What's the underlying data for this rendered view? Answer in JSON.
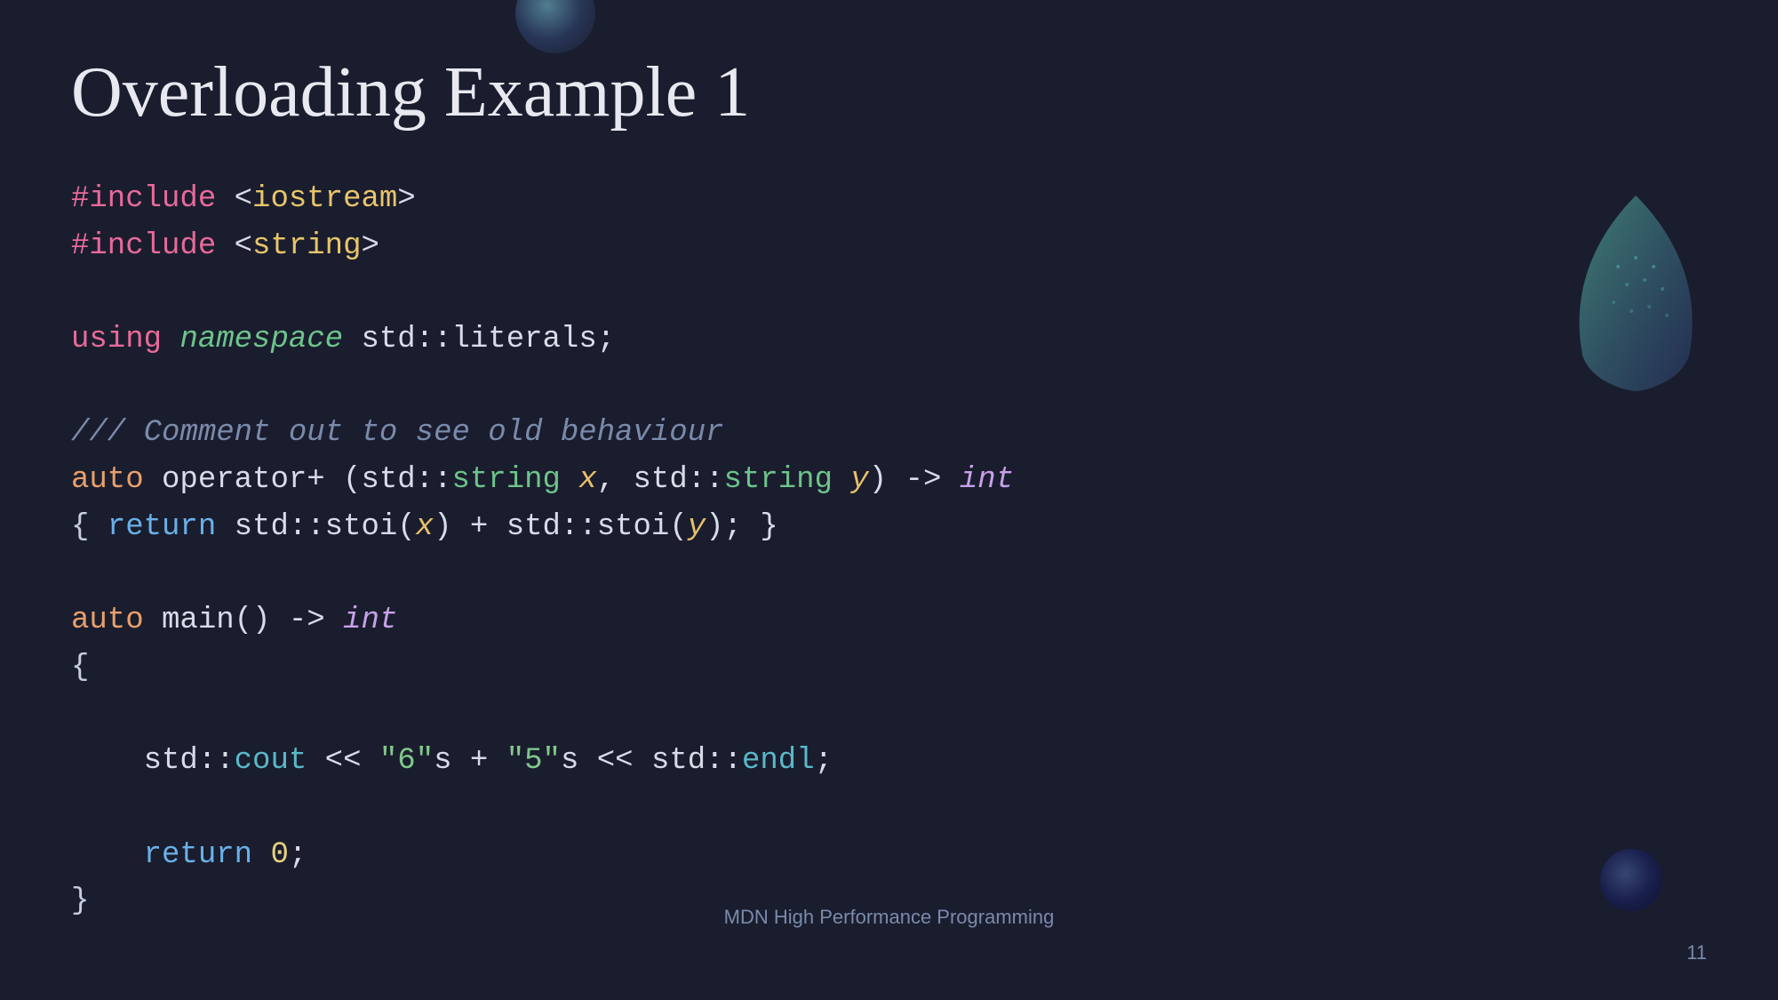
{
  "title": "Overloading Example 1",
  "footer": {
    "center": "MDN High Performance Programming",
    "page_number": "11"
  },
  "code": {
    "lines": [
      {
        "id": "include1",
        "parts": [
          {
            "text": "#include",
            "class": "c-pink"
          },
          {
            "text": " <",
            "class": "c-white"
          },
          {
            "text": "iostream",
            "class": "c-yellow"
          },
          {
            "text": ">",
            "class": "c-white"
          }
        ]
      },
      {
        "id": "include2",
        "parts": [
          {
            "text": "#include",
            "class": "c-pink"
          },
          {
            "text": " <",
            "class": "c-white"
          },
          {
            "text": "string",
            "class": "c-yellow"
          },
          {
            "text": ">",
            "class": "c-white"
          }
        ]
      },
      {
        "id": "empty1",
        "parts": []
      },
      {
        "id": "using",
        "parts": [
          {
            "text": "using",
            "class": "c-pink"
          },
          {
            "text": " ",
            "class": ""
          },
          {
            "text": "namespace",
            "class": "c-italic-green"
          },
          {
            "text": " std::literals;",
            "class": "c-white"
          }
        ]
      },
      {
        "id": "empty2",
        "parts": []
      },
      {
        "id": "comment",
        "parts": [
          {
            "text": "/// Comment out to see old behaviour",
            "class": "c-comment"
          }
        ]
      },
      {
        "id": "operator",
        "parts": [
          {
            "text": "auto",
            "class": "c-orange"
          },
          {
            "text": " operator+ (std::",
            "class": "c-white"
          },
          {
            "text": "string",
            "class": "c-green"
          },
          {
            "text": " ",
            "class": "c-white"
          },
          {
            "text": "x",
            "class": "c-italic-xy"
          },
          {
            "text": ", std::",
            "class": "c-white"
          },
          {
            "text": "string",
            "class": "c-green"
          },
          {
            "text": " ",
            "class": "c-white"
          },
          {
            "text": "y",
            "class": "c-italic-xy"
          },
          {
            "text": ") -> ",
            "class": "c-white"
          },
          {
            "text": "int",
            "class": "c-italic-int"
          }
        ]
      },
      {
        "id": "operator_body",
        "parts": [
          {
            "text": "{ ",
            "class": "c-brace"
          },
          {
            "text": "return",
            "class": "c-blue"
          },
          {
            "text": " std::stoi(",
            "class": "c-white"
          },
          {
            "text": "x",
            "class": "c-italic-xy"
          },
          {
            "text": ") + std::stoi(",
            "class": "c-white"
          },
          {
            "text": "y",
            "class": "c-italic-xy"
          },
          {
            "text": "); }",
            "class": "c-white"
          }
        ]
      },
      {
        "id": "empty3",
        "parts": []
      },
      {
        "id": "main_decl",
        "parts": [
          {
            "text": "auto",
            "class": "c-orange"
          },
          {
            "text": " main() -> ",
            "class": "c-white"
          },
          {
            "text": "int",
            "class": "c-italic-int"
          }
        ]
      },
      {
        "id": "open_brace",
        "parts": [
          {
            "text": "{",
            "class": "c-brace"
          }
        ]
      },
      {
        "id": "empty4",
        "parts": []
      },
      {
        "id": "cout_line",
        "parts": [
          {
            "text": "    std::",
            "class": "c-teal"
          },
          {
            "text": "cout",
            "class": "c-teal"
          },
          {
            "text": " << ",
            "class": "c-white"
          },
          {
            "text": "\"6\"",
            "class": "c-str-green"
          },
          {
            "text": "s + ",
            "class": "c-white"
          },
          {
            "text": "\"5\"",
            "class": "c-str-green"
          },
          {
            "text": "s << std::",
            "class": "c-white"
          },
          {
            "text": "endl",
            "class": "c-teal"
          },
          {
            "text": ";",
            "class": "c-white"
          }
        ]
      },
      {
        "id": "empty5",
        "parts": []
      },
      {
        "id": "return_line",
        "parts": [
          {
            "text": "    ",
            "class": ""
          },
          {
            "text": "return",
            "class": "c-blue"
          },
          {
            "text": " ",
            "class": "c-white"
          },
          {
            "text": "0",
            "class": "c-num"
          },
          {
            "text": ";",
            "class": "c-white"
          }
        ]
      },
      {
        "id": "close_brace",
        "parts": [
          {
            "text": "}",
            "class": "c-brace"
          }
        ]
      }
    ]
  }
}
